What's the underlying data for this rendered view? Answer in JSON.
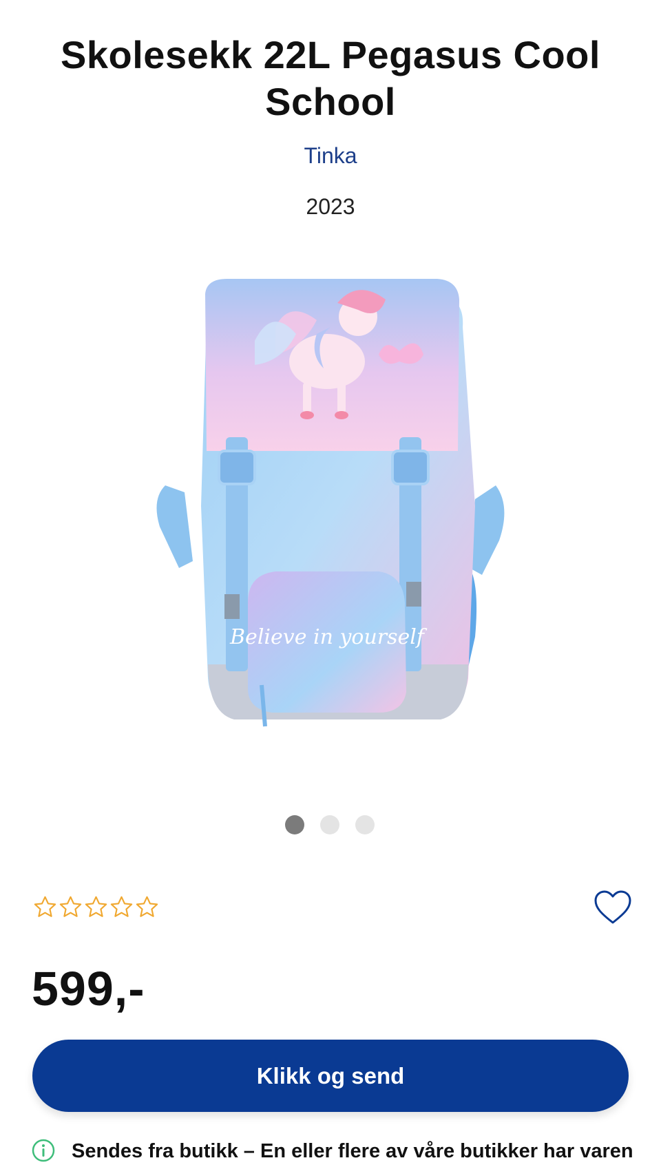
{
  "product": {
    "title": "Skolesekk 22L Pegasus Cool School",
    "brand": "Tinka",
    "year": "2023",
    "image_alt": "Skolesekk 22L Pegasus Cool School",
    "backpack_text": "Believe in yourself",
    "price": "599,-"
  },
  "gallery": {
    "image_count": 3,
    "active_index": 0
  },
  "rating": {
    "stars": 5,
    "filled": 0,
    "star_color": "#f0a830"
  },
  "actions": {
    "cta_label": "Klikk og send",
    "favorite_icon": "heart-outline-icon"
  },
  "shipping": {
    "icon": "info-icon",
    "text": "Sendes fra butikk – En eller flere av våre butikker har varen"
  },
  "colors": {
    "cta": "#0a3a93",
    "brand_link": "#1d3f8a",
    "info_icon": "#3ebd7a"
  }
}
